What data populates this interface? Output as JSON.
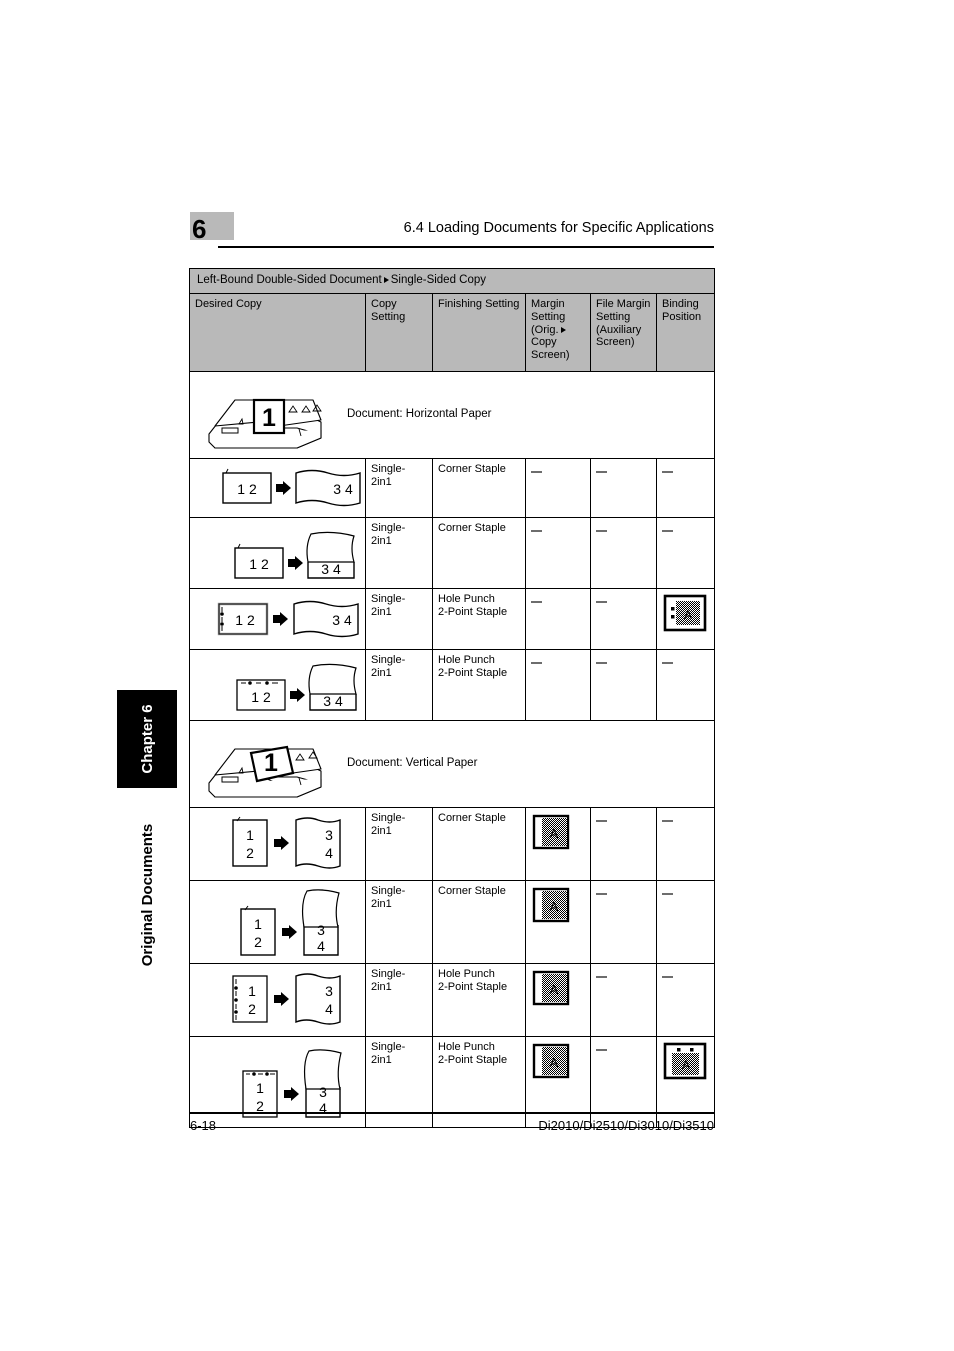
{
  "page": {
    "chapter_number": "6",
    "header_title": "6.4 Loading Documents for Specific Applications",
    "side_tab": "Chapter 6",
    "side_caption": "Original Documents",
    "footer_page": "6-18",
    "footer_models": "Di2010/Di2510/Di3010/Di3510"
  },
  "table": {
    "title_prefix": "Left-Bound Double-Sided Document",
    "title_suffix": "Single-Sided Copy",
    "headers": {
      "desired_copy": "Desired Copy",
      "copy_setting": "Copy Setting",
      "finishing_setting": "Finishing Setting",
      "margin_setting_l1": "Margin Setting",
      "margin_setting_l2": "(Orig.",
      "margin_setting_l3": "Copy Screen)",
      "file_margin_setting": "File Margin Setting (Auxiliary Screen)",
      "binding_position": "Binding Position"
    },
    "sections": [
      {
        "illustration_caption": "Document: Horizontal Paper",
        "illustration_sheet_label": "1",
        "rows": [
          {
            "orientation": "horizontal",
            "source_label": "1 2",
            "target_label": "3 4",
            "target_style": "curved-right",
            "marks": "none",
            "copy_setting": "Single-2in1",
            "finishing_setting": "Corner Staple",
            "margin_setting": "—",
            "file_margin_setting": "—",
            "binding_position": "—"
          },
          {
            "orientation": "horizontal",
            "source_label": "1 2",
            "target_label": "3 4",
            "target_style": "curved-top",
            "marks": "none",
            "copy_setting": "Single-2in1",
            "finishing_setting": "Corner Staple",
            "margin_setting": "—",
            "file_margin_setting": "—",
            "binding_position": "—"
          },
          {
            "orientation": "horizontal",
            "source_label": "1 2",
            "target_label": "3 4",
            "target_style": "curved-right",
            "marks": "left-punch",
            "copy_setting": "Single-2in1",
            "finishing_setting": "Hole Punch 2-Point Staple",
            "margin_setting": "—",
            "file_margin_setting": "—",
            "binding_position": "icon-left-dots"
          },
          {
            "orientation": "horizontal",
            "source_label": "1 2",
            "target_label": "3 4",
            "target_style": "curved-top",
            "marks": "top-punch",
            "copy_setting": "Single-2in1",
            "finishing_setting": "Hole Punch 2-Point Staple",
            "margin_setting": "—",
            "file_margin_setting": "—",
            "binding_position": "—"
          }
        ]
      },
      {
        "illustration_caption": "Document: Vertical Paper",
        "illustration_sheet_label": "1",
        "rows": [
          {
            "orientation": "vertical",
            "source_label_top": "1",
            "source_label_bottom": "2",
            "target_label_top": "3",
            "target_label_bottom": "4",
            "target_style": "curved-right",
            "marks": "corner-tick",
            "copy_setting": "Single-2in1",
            "finishing_setting": "Corner Staple",
            "margin_setting": "icon-left-bar",
            "file_margin_setting": "—",
            "binding_position": "—"
          },
          {
            "orientation": "vertical",
            "source_label_top": "1",
            "source_label_bottom": "2",
            "target_label_top": "3",
            "target_label_bottom": "4",
            "target_style": "curved-top",
            "marks": "corner-tick",
            "copy_setting": "Single-2in1",
            "finishing_setting": "Corner Staple",
            "margin_setting": "icon-left-bar",
            "file_margin_setting": "—",
            "binding_position": "—"
          },
          {
            "orientation": "vertical",
            "source_label_top": "1",
            "source_label_bottom": "2",
            "target_label_top": "3",
            "target_label_bottom": "4",
            "target_style": "curved-right",
            "marks": "left-punch",
            "copy_setting": "Single-2in1",
            "finishing_setting": "Hole Punch 2-Point Staple",
            "margin_setting": "icon-left-bar",
            "file_margin_setting": "—",
            "binding_position": "—"
          },
          {
            "orientation": "vertical",
            "source_label_top": "1",
            "source_label_bottom": "2",
            "target_label_top": "3",
            "target_label_bottom": "4",
            "target_style": "curved-top",
            "marks": "top-punch",
            "copy_setting": "Single-2in1",
            "finishing_setting": "Hole Punch 2-Point Staple",
            "margin_setting": "icon-left-bar",
            "file_margin_setting": "—",
            "binding_position": "icon-top-dots"
          }
        ]
      }
    ]
  }
}
